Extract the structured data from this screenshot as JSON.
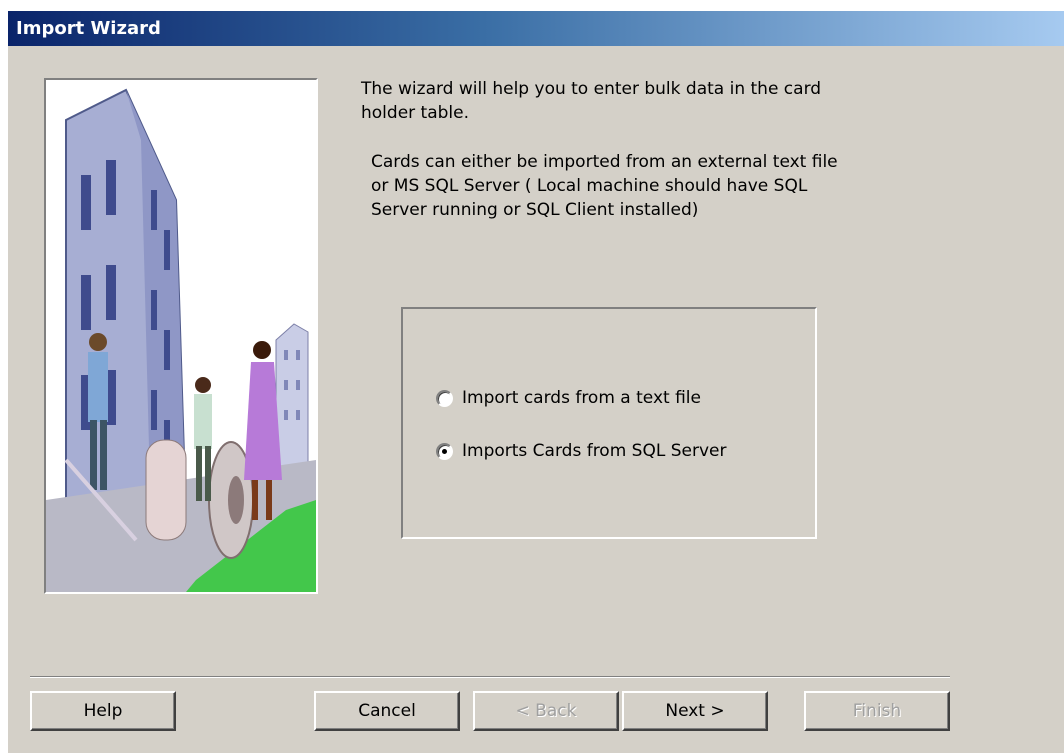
{
  "window": {
    "title": "Import Wizard"
  },
  "intro": {
    "line1": "The wizard will help you to enter bulk data in the card",
    "line2": "holder table."
  },
  "details": {
    "line1": "Cards can either be imported from an external text file",
    "line2": "or MS SQL Server ( Local machine should have SQL",
    "line3": "Server running or SQL Client installed)"
  },
  "options": [
    {
      "label": "Import cards from a text file",
      "selected": false
    },
    {
      "label": "Imports Cards from SQL Server",
      "selected": true
    }
  ],
  "buttons": {
    "help": "Help",
    "cancel": "Cancel",
    "back": "< Back",
    "next": "Next >",
    "finish": "Finish"
  }
}
